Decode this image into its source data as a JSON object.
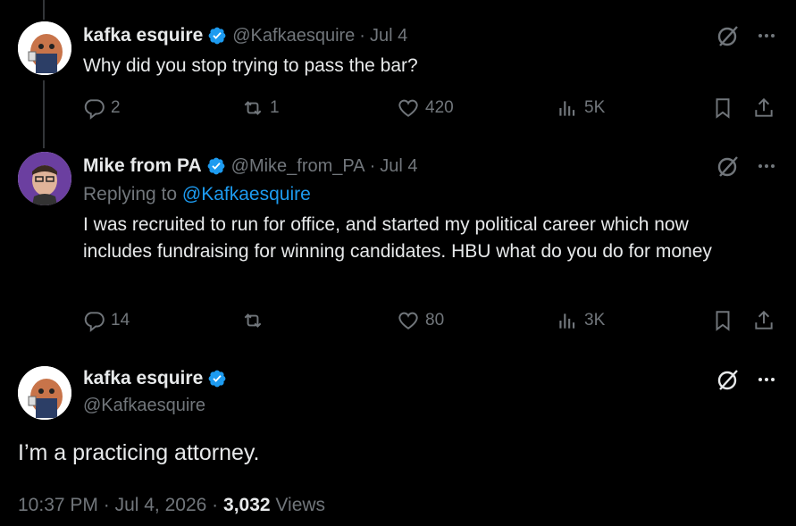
{
  "tweets": [
    {
      "name": "kafka esquire",
      "handle": "@Kafkaesquire",
      "sep": "·",
      "date": "Jul 4",
      "text": "Why did you stop trying to pass the bar?",
      "replies": "2",
      "reposts": "1",
      "likes": "420",
      "views": "5K"
    },
    {
      "name": "Mike from PA",
      "handle": "@Mike_from_PA",
      "sep": "·",
      "date": "Jul 4",
      "replying_prefix": "Replying to ",
      "replying_to": "@Kafkaesquire",
      "text": "I was recruited to run for office, and started my political career which now includes fundraising for winning candidates. HBU what do you do for money",
      "replies": "14",
      "reposts": "",
      "likes": "80",
      "views": "3K"
    }
  ],
  "main": {
    "name": "kafka esquire",
    "handle": "@Kafkaesquire",
    "text": "I’m a practicing attorney.",
    "time": "10:37 PM",
    "sep1": "·",
    "date": "Jul 4, 2026",
    "sep2": "·",
    "views_count": "3,032",
    "views_label": "Views"
  },
  "colors": {
    "background": "#000000",
    "text": "#e7e9ea",
    "secondary": "#71767b",
    "accent": "#1d9bf0",
    "verified": "#1d9bf0"
  },
  "icons": {
    "reply": "reply-icon",
    "repost": "repost-icon",
    "like": "heart-icon",
    "views": "views-icon",
    "bookmark": "bookmark-icon",
    "share": "share-icon",
    "grok": "grok-icon",
    "more": "more-icon",
    "verified": "verified-badge-icon"
  }
}
